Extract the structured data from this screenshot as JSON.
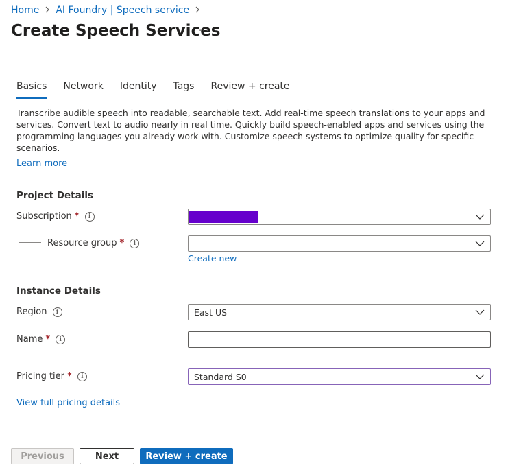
{
  "breadcrumb": {
    "items": [
      "Home",
      "AI Foundry | Speech service"
    ]
  },
  "page": {
    "title": "Create Speech Services",
    "more_label": "···"
  },
  "tabs": [
    "Basics",
    "Network",
    "Identity",
    "Tags",
    "Review + create"
  ],
  "active_tab": "Basics",
  "description": "Transcribe audible speech into readable, searchable text. Add real-time speech translations to your apps and services. Convert text to audio nearly in real time. Quickly build speech-enabled apps and services using the programming languages you already work with. Customize speech systems to optimize quality for specific scenarios.",
  "learn_more": "Learn more",
  "project_details": {
    "heading": "Project Details",
    "subscription": {
      "label": "Subscription",
      "value": ""
    },
    "resource_group": {
      "label": "Resource group",
      "value": "",
      "create_new": "Create new"
    }
  },
  "instance_details": {
    "heading": "Instance Details",
    "region": {
      "label": "Region",
      "value": "East US"
    },
    "name": {
      "label": "Name",
      "value": ""
    },
    "pricing_tier": {
      "label": "Pricing tier",
      "value": "Standard S0"
    },
    "view_pricing": "View full pricing details"
  },
  "required_mark": "*",
  "footer": {
    "previous": "Previous",
    "next": "Next",
    "review_create": "Review + create"
  },
  "colors": {
    "accent": "#0f6cbd",
    "required": "#a4262c",
    "masked_value": "#6600cc",
    "focus_border": "#8764b8"
  },
  "icons": {
    "breadcrumb_separator": "chevron-right-icon",
    "dropdown": "chevron-down-icon",
    "info": "info-icon"
  }
}
